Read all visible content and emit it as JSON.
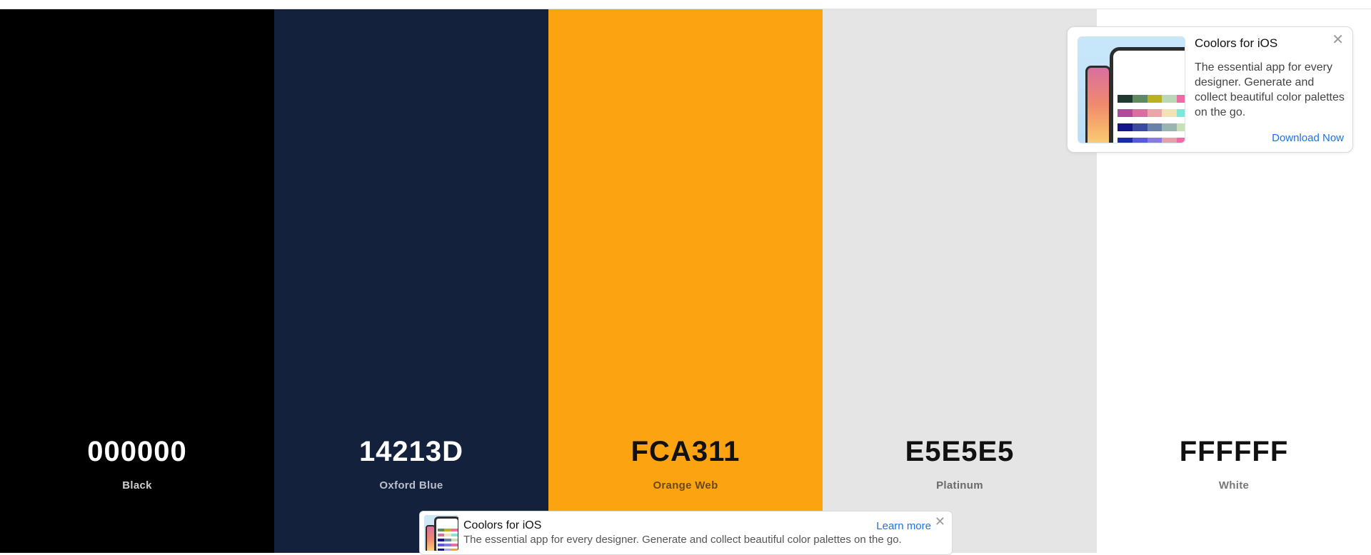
{
  "palette": {
    "swatches": [
      {
        "hex": "000000",
        "name": "Black",
        "bg": "#000000",
        "hex_color": "#ffffff",
        "name_color": "#cfcfcf"
      },
      {
        "hex": "14213D",
        "name": "Oxford Blue",
        "bg": "#14213D",
        "hex_color": "#ffffff",
        "name_color": "#b9bfcc"
      },
      {
        "hex": "FCA311",
        "name": "Orange Web",
        "bg": "#FCA311",
        "hex_color": "#111111",
        "name_color": "#6b4a10"
      },
      {
        "hex": "E5E5E5",
        "name": "Platinum",
        "bg": "#E5E5E5",
        "hex_color": "#111111",
        "name_color": "#6a6a6a"
      },
      {
        "hex": "FFFFFF",
        "name": "White",
        "bg": "#FFFFFF",
        "hex_color": "#111111",
        "name_color": "#777777"
      }
    ]
  },
  "ad_card": {
    "title": "Coolors for iOS",
    "description": "The essential app for every designer. Generate and collect beautiful color palettes on the go.",
    "cta": "Download Now",
    "close_glyph": "✕"
  },
  "ad_banner": {
    "title": "Coolors for iOS",
    "description": "The essential app for every designer. Generate and collect beautiful color palettes on the go.",
    "cta": "Learn more",
    "close_glyph": "✕"
  },
  "colors": {
    "accent_link": "#1a73e8"
  }
}
